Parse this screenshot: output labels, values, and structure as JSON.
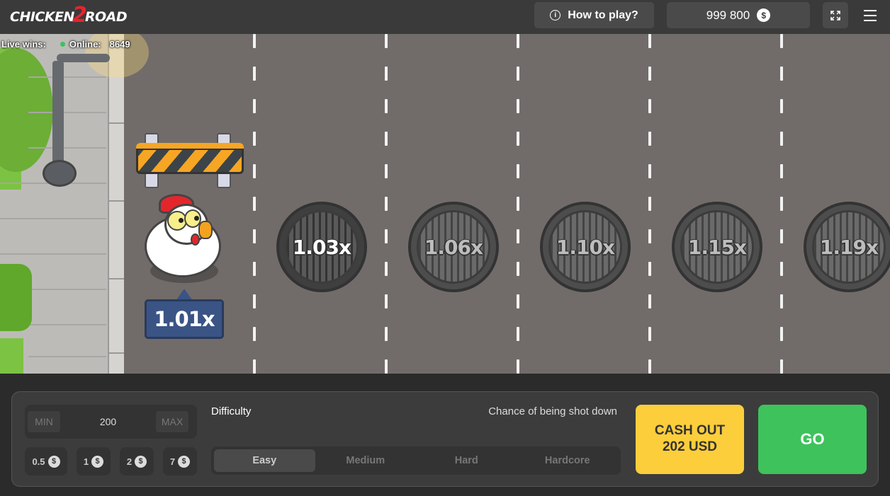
{
  "header": {
    "logo_left": "CHICKEN",
    "logo_mid": "2",
    "logo_right": "ROAD",
    "how_to_play": "How to play?",
    "balance": "999 800",
    "currency_icon": "dollar-coin-icon"
  },
  "ticker": {
    "live_wins_label": "Live wins:",
    "online_label": "Online:",
    "online_count": "8649"
  },
  "game": {
    "current_multiplier": "1.01x",
    "manholes": [
      {
        "label": "1.03x",
        "active": true
      },
      {
        "label": "1.06x",
        "active": false
      },
      {
        "label": "1.10x",
        "active": false
      },
      {
        "label": "1.15x",
        "active": false
      },
      {
        "label": "1.19x",
        "active": false
      }
    ]
  },
  "controls": {
    "min_label": "MIN",
    "bet_value": "200",
    "max_label": "MAX",
    "chips": [
      "0.5",
      "1",
      "2",
      "7"
    ],
    "difficulty_label": "Difficulty",
    "chance_label": "Chance of being shot down",
    "difficulties": [
      "Easy",
      "Medium",
      "Hard",
      "Hardcore"
    ],
    "selected_difficulty": "Easy",
    "cashout_line1": "CASH OUT",
    "cashout_line2": "202 USD",
    "go_label": "GO"
  },
  "colors": {
    "go": "#3ec25c",
    "cashout": "#fcce3b",
    "multiplier_badge": "#3a5485",
    "brand_red": "#e8232d"
  }
}
